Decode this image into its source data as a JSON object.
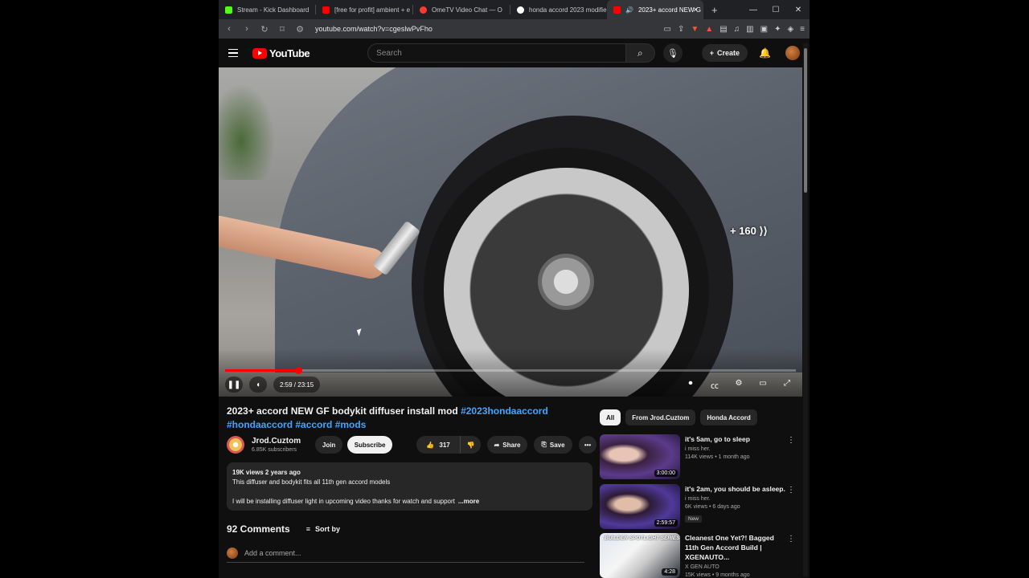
{
  "browser": {
    "tabs": [
      {
        "label": "Stream - Kick Dashboard",
        "color": "#53fc18"
      },
      {
        "label": "[free for profit] ambient + e",
        "color": "#ff0000"
      },
      {
        "label": "OmeTV Video Chat — O",
        "color": "#ff3b30"
      },
      {
        "label": "honda accord 2023 modifie",
        "color": "#ffffff"
      },
      {
        "label": "2023+ accord NEW G",
        "color": "#ff0000"
      }
    ],
    "new_tab": "+",
    "url": "youtube.com/watch?v=cgeslwPvFho"
  },
  "header": {
    "logo_text": "YouTube",
    "search_placeholder": "Search",
    "create_label": "Create"
  },
  "player": {
    "skip_label": "+ 160",
    "current_time": "2:59",
    "duration": "23:15",
    "progress_fraction": 0.128,
    "time_display": "2:59 / 23:15"
  },
  "video": {
    "title_main": "2023+ accord NEW GF bodykit diffuser install mod ",
    "title_tag1": "#2023hondaaccord",
    "title_tags_rest": "#hondaaccord #accord #mods",
    "channel_name": "Jrod.Cuztom",
    "subscribers": "6.85K subscribers",
    "join_label": "Join",
    "subscribe_label": "Subscribe",
    "like_count": "317",
    "share_label": "Share",
    "save_label": "Save"
  },
  "description": {
    "meta": "19K views  2 years ago",
    "line1": "This diffuser and bodykit fits all 11th gen accord models",
    "line2": "I will be installing diffuser light in upcoming video thanks for watch and support",
    "more_label": "...more"
  },
  "comments": {
    "count_label": "92 Comments",
    "sort_label": "Sort by",
    "add_placeholder": "Add a comment..."
  },
  "chips": [
    "All",
    "From Jrod.Cuztom",
    "Honda Accord"
  ],
  "recommendations": [
    {
      "title": "it's 5am, go to sleep",
      "channel": "i miss her.",
      "stats": "114K views • 1 month ago",
      "duration": "3:00:00",
      "badge": ""
    },
    {
      "title": "it's 2am, you should be asleep.",
      "channel": "i miss her.",
      "stats": "6K views • 6 days ago",
      "duration": "2:59:57",
      "badge": "New"
    },
    {
      "title": "Cleanest One Yet?! Bagged 11th Gen Accord Build | XGENAUTO...",
      "channel": "X GEN AUTO",
      "stats": "15K views • 9 months ago",
      "duration": "4:28",
      "badge": "",
      "banner": "BUILDER SPOTLIGHT SERIES"
    }
  ],
  "colors": {
    "accent_red": "#ff0000",
    "link_blue": "#3ea6ff",
    "background": "#0f0f0f"
  }
}
